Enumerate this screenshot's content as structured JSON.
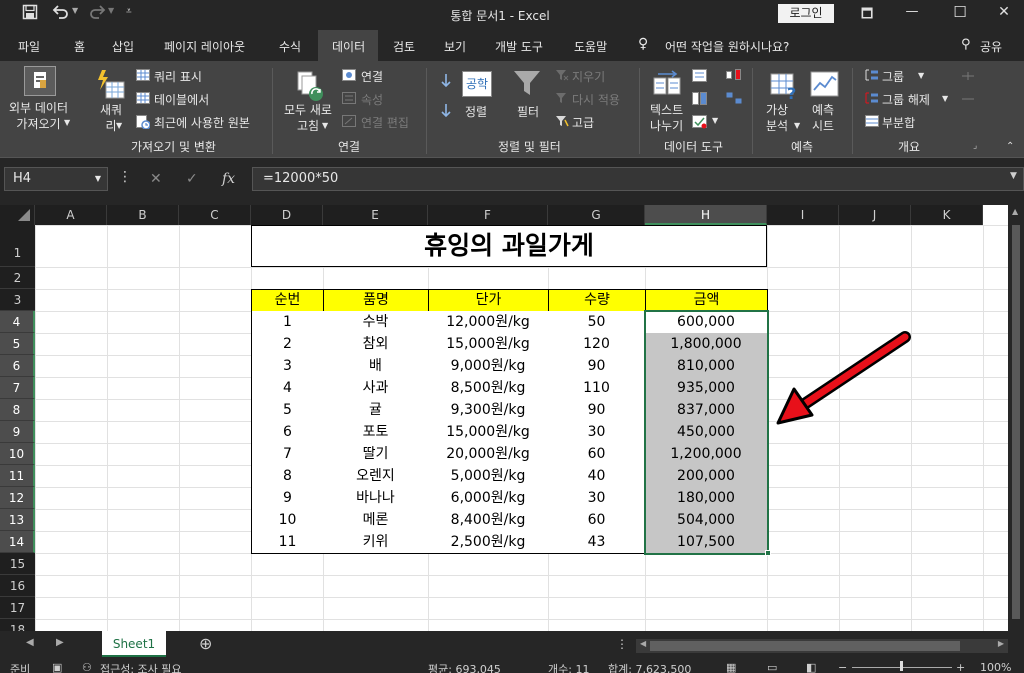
{
  "titlebar": {
    "doc_title": "통합 문서1  -  Excel",
    "login_label": "로그인",
    "save_icon": "save-icon",
    "undo_icon": "undo-icon",
    "redo_icon": "redo-icon",
    "customize_icon": "customize-qat-icon",
    "restore_glyph": "🗖",
    "min_glyph": "—",
    "max_glyph": "☐",
    "close_glyph": "✕"
  },
  "menu": {
    "items": [
      "파일",
      "홈",
      "삽입",
      "페이지 레이아웃",
      "수식",
      "데이터",
      "검토",
      "보기",
      "개발 도구",
      "도움말"
    ],
    "search_label": "어떤 작업을 원하시나요?",
    "share_label": "공유"
  },
  "ribbon": {
    "external_data": "외부 데이터\n가져오기",
    "new_query": "새쿼\n리",
    "query_show": "쿼리 표시",
    "from_table": "테이블에서",
    "recent_sources": "최근에 사용한 원본",
    "group_get_transform": "가져오기 및 변환",
    "refresh_all": "모두 새로\n고침",
    "connections": "연결",
    "properties": "속성",
    "edit_links": "연결 편집",
    "group_connections": "연결",
    "sort_az_glyph": "공학",
    "sort": "정렬",
    "filter": "필터",
    "clear": "지우기",
    "reapply": "다시 적용",
    "advanced": "고급",
    "group_sort_filter": "정렬 및 필터",
    "text_to_columns": "텍스트\n나누기",
    "group_data_tools": "데이터 도구",
    "what_if": "가상\n분석",
    "forecast_sheet": "예측\n시트",
    "group_forecast": "예측",
    "group": "그룹",
    "ungroup": "그룹 해제",
    "subtotal": "부분합",
    "group_outline": "개요"
  },
  "formula": {
    "name_box": "H4",
    "formula": "=12000*50",
    "fx": "fx"
  },
  "grid": {
    "columns": [
      "A",
      "B",
      "C",
      "D",
      "E",
      "F",
      "G",
      "H",
      "I",
      "J",
      "K"
    ],
    "rows": [
      "1",
      "2",
      "3",
      "4",
      "5",
      "6",
      "7",
      "8",
      "9",
      "10",
      "11",
      "12",
      "13",
      "14",
      "15",
      "16",
      "17",
      "18"
    ],
    "sheet_title": "휴잉의 과일가게",
    "table_headers": [
      "순번",
      "품명",
      "단가",
      "수량",
      "금액"
    ],
    "table_rows": [
      [
        "1",
        "수박",
        "12,000원/kg",
        "50",
        "600,000"
      ],
      [
        "2",
        "참외",
        "15,000원/kg",
        "120",
        "1,800,000"
      ],
      [
        "3",
        "배",
        "9,000원/kg",
        "90",
        "810,000"
      ],
      [
        "4",
        "사과",
        "8,500원/kg",
        "110",
        "935,000"
      ],
      [
        "5",
        "귤",
        "9,300원/kg",
        "90",
        "837,000"
      ],
      [
        "6",
        "포토",
        "15,000원/kg",
        "30",
        "450,000"
      ],
      [
        "7",
        "딸기",
        "20,000원/kg",
        "60",
        "1,200,000"
      ],
      [
        "8",
        "오렌지",
        "5,000원/kg",
        "40",
        "200,000"
      ],
      [
        "9",
        "바나나",
        "6,000원/kg",
        "30",
        "180,000"
      ],
      [
        "10",
        "메론",
        "8,400원/kg",
        "60",
        "504,000"
      ],
      [
        "11",
        "키위",
        "2,500원/kg",
        "43",
        "107,500"
      ]
    ],
    "header_fill": "#ffff00",
    "selection_fill": "#c6c6c6",
    "arrow_color": "#e8101a"
  },
  "sheets": {
    "tabs": [
      "Sheet1"
    ],
    "add_glyph": "⊕"
  },
  "status": {
    "ready": "준비",
    "accessibility": "접근성: 조사 필요",
    "average": "평균: 693,045",
    "count": "개수: 11",
    "sum": "합계: 7,623,500",
    "zoom": "100%"
  }
}
